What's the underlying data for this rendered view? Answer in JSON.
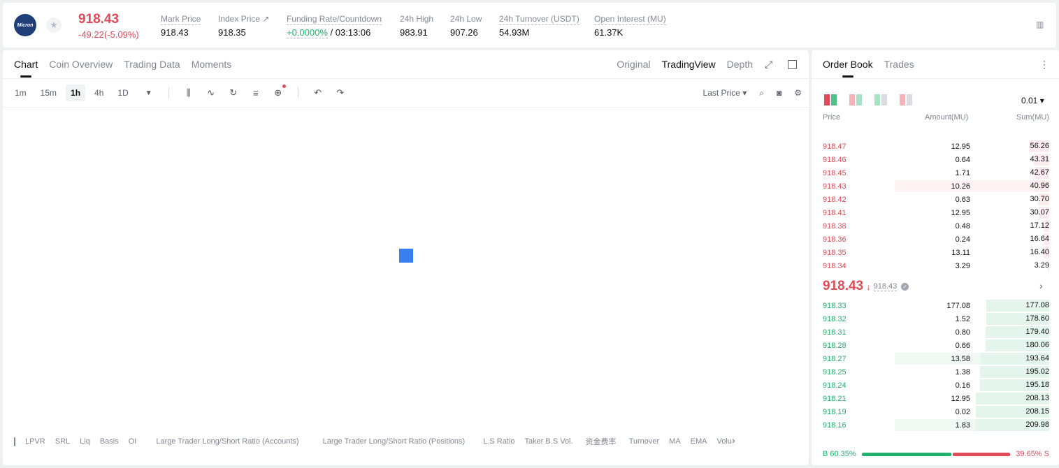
{
  "ticker": {
    "logo_text": "Micron",
    "last_price": "918.43",
    "change": "-49.22(-5.09%)",
    "stats": [
      {
        "label": "Mark Price",
        "value": "918.43"
      },
      {
        "label": "Index Price ↗",
        "value": "918.35"
      },
      {
        "label": "Funding Rate/Countdown",
        "value_green": "+0.0000%",
        "value": " / 03:13:06"
      },
      {
        "label": "24h High",
        "value": "983.91"
      },
      {
        "label": "24h Low",
        "value": "907.26"
      },
      {
        "label": "24h Turnover (USDT)",
        "value": "54.93M"
      },
      {
        "label": "Open Interest (MU)",
        "value": "61.37K"
      }
    ]
  },
  "chart_panel": {
    "tabs": [
      "Chart",
      "Coin Overview",
      "Trading Data",
      "Moments"
    ],
    "view_tabs": [
      "Original",
      "TradingView",
      "Depth"
    ],
    "timeframes": [
      "1m",
      "15m",
      "1h",
      "4h",
      "1D"
    ],
    "active_timeframe": "1h",
    "price_source": "Last Price ▾",
    "indicators": [
      "LPVR",
      "SRL",
      "Liq",
      "Basis",
      "OI",
      "Large Trader Long/Short Ratio (Accounts)",
      "Large Trader Long/Short Ratio (Positions)",
      "L.S Ratio",
      "Taker B.S Vol.",
      "资金费率",
      "Turnover",
      "MA",
      "EMA",
      "Volu"
    ]
  },
  "order_book": {
    "tabs": [
      "Order Book",
      "Trades"
    ],
    "precision": "0.01 ▾",
    "columns": {
      "price": "Price",
      "amount": "Amount(MU)",
      "sum": "Sum(MU)"
    },
    "asks": [
      {
        "price": "918.47",
        "amount": "12.95",
        "sum": "56.26",
        "depth": 0.27,
        "size": 0
      },
      {
        "price": "918.46",
        "amount": "0.64",
        "sum": "43.31",
        "depth": 0.21,
        "size": 0
      },
      {
        "price": "918.45",
        "amount": "1.71",
        "sum": "42.67",
        "depth": 0.2,
        "size": 0
      },
      {
        "price": "918.43",
        "amount": "10.26",
        "sum": "40.96",
        "depth": 0.2,
        "size": 0.5
      },
      {
        "price": "918.42",
        "amount": "0.63",
        "sum": "30.70",
        "depth": 0.15,
        "size": 0
      },
      {
        "price": "918.41",
        "amount": "12.95",
        "sum": "30.07",
        "depth": 0.14,
        "size": 0
      },
      {
        "price": "918.38",
        "amount": "0.48",
        "sum": "17.12",
        "depth": 0.08,
        "size": 0
      },
      {
        "price": "918.36",
        "amount": "0.24",
        "sum": "16.64",
        "depth": 0.08,
        "size": 0
      },
      {
        "price": "918.35",
        "amount": "13.11",
        "sum": "16.40",
        "depth": 0.08,
        "size": 0
      },
      {
        "price": "918.34",
        "amount": "3.29",
        "sum": "3.29",
        "depth": 0.02,
        "size": 0
      }
    ],
    "mid_price": "918.43",
    "mark_price": "918.43",
    "bids": [
      {
        "price": "918.33",
        "amount": "177.08",
        "sum": "177.08",
        "depth": 0.85,
        "size": 0
      },
      {
        "price": "918.32",
        "amount": "1.52",
        "sum": "178.60",
        "depth": 0.85,
        "size": 0
      },
      {
        "price": "918.31",
        "amount": "0.80",
        "sum": "179.40",
        "depth": 0.86,
        "size": 0
      },
      {
        "price": "918.28",
        "amount": "0.66",
        "sum": "180.06",
        "depth": 0.86,
        "size": 0
      },
      {
        "price": "918.27",
        "amount": "13.58",
        "sum": "193.64",
        "depth": 0.92,
        "size": 0.5
      },
      {
        "price": "918.25",
        "amount": "1.38",
        "sum": "195.02",
        "depth": 0.93,
        "size": 0
      },
      {
        "price": "918.24",
        "amount": "0.16",
        "sum": "195.18",
        "depth": 0.93,
        "size": 0
      },
      {
        "price": "918.21",
        "amount": "12.95",
        "sum": "208.13",
        "depth": 0.99,
        "size": 0
      },
      {
        "price": "918.19",
        "amount": "0.02",
        "sum": "208.15",
        "depth": 0.99,
        "size": 0
      },
      {
        "price": "918.16",
        "amount": "1.83",
        "sum": "209.98",
        "depth": 1.0,
        "size": 0.5
      }
    ],
    "buy_ratio_label": "B 60.35%",
    "sell_ratio_label": "39.65% S",
    "buy_ratio": 0.6035
  },
  "colors": {
    "sell": "#e04a59",
    "buy": "#20b26c",
    "loader": "#3a7ff0"
  }
}
